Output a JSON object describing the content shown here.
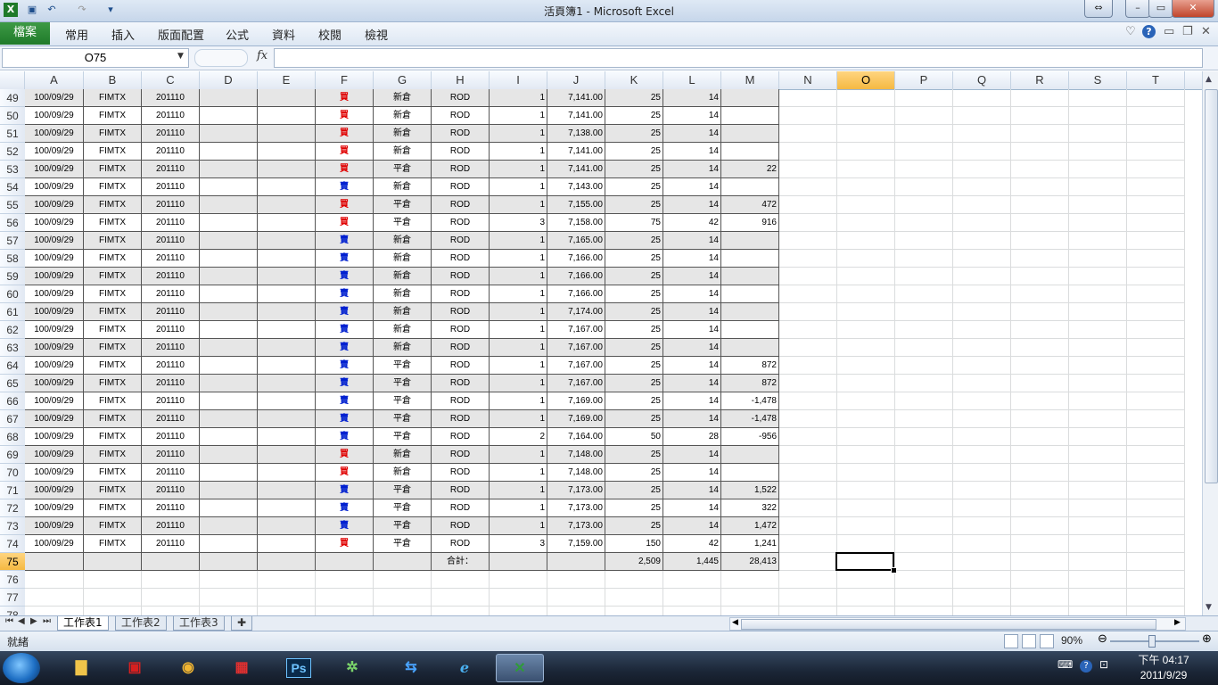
{
  "window": {
    "title": "活頁簿1 - Microsoft Excel"
  },
  "ribbon": {
    "file_tab": "檔案",
    "tabs": [
      "常用",
      "插入",
      "版面配置",
      "公式",
      "資料",
      "校閱",
      "檢視"
    ]
  },
  "formula_bar": {
    "name_box": "O75",
    "fx_label": "fx",
    "value": ""
  },
  "columns": [
    "A",
    "B",
    "C",
    "D",
    "E",
    "F",
    "G",
    "H",
    "I",
    "J",
    "K",
    "L",
    "M",
    "N",
    "O",
    "P",
    "Q",
    "R",
    "S",
    "T"
  ],
  "selected_column": "O",
  "selected_row": "75",
  "rows": [
    {
      "n": "49",
      "a": "100/09/29",
      "b": "FIMTX",
      "c": "201110",
      "f": "買",
      "side": "buy",
      "g": "新倉",
      "h": "ROD",
      "i": "1",
      "j": "7,141.00",
      "k": "25",
      "l": "14",
      "m": ""
    },
    {
      "n": "50",
      "a": "100/09/29",
      "b": "FIMTX",
      "c": "201110",
      "f": "買",
      "side": "buy",
      "g": "新倉",
      "h": "ROD",
      "i": "1",
      "j": "7,141.00",
      "k": "25",
      "l": "14",
      "m": ""
    },
    {
      "n": "51",
      "a": "100/09/29",
      "b": "FIMTX",
      "c": "201110",
      "f": "買",
      "side": "buy",
      "g": "新倉",
      "h": "ROD",
      "i": "1",
      "j": "7,138.00",
      "k": "25",
      "l": "14",
      "m": ""
    },
    {
      "n": "52",
      "a": "100/09/29",
      "b": "FIMTX",
      "c": "201110",
      "f": "買",
      "side": "buy",
      "g": "新倉",
      "h": "ROD",
      "i": "1",
      "j": "7,141.00",
      "k": "25",
      "l": "14",
      "m": ""
    },
    {
      "n": "53",
      "a": "100/09/29",
      "b": "FIMTX",
      "c": "201110",
      "f": "買",
      "side": "buy",
      "g": "平倉",
      "h": "ROD",
      "i": "1",
      "j": "7,141.00",
      "k": "25",
      "l": "14",
      "m": "22"
    },
    {
      "n": "54",
      "a": "100/09/29",
      "b": "FIMTX",
      "c": "201110",
      "f": "賣",
      "side": "sell",
      "g": "新倉",
      "h": "ROD",
      "i": "1",
      "j": "7,143.00",
      "k": "25",
      "l": "14",
      "m": ""
    },
    {
      "n": "55",
      "a": "100/09/29",
      "b": "FIMTX",
      "c": "201110",
      "f": "買",
      "side": "buy",
      "g": "平倉",
      "h": "ROD",
      "i": "1",
      "j": "7,155.00",
      "k": "25",
      "l": "14",
      "m": "472"
    },
    {
      "n": "56",
      "a": "100/09/29",
      "b": "FIMTX",
      "c": "201110",
      "f": "買",
      "side": "buy",
      "g": "平倉",
      "h": "ROD",
      "i": "3",
      "j": "7,158.00",
      "k": "75",
      "l": "42",
      "m": "916"
    },
    {
      "n": "57",
      "a": "100/09/29",
      "b": "FIMTX",
      "c": "201110",
      "f": "賣",
      "side": "sell",
      "g": "新倉",
      "h": "ROD",
      "i": "1",
      "j": "7,165.00",
      "k": "25",
      "l": "14",
      "m": ""
    },
    {
      "n": "58",
      "a": "100/09/29",
      "b": "FIMTX",
      "c": "201110",
      "f": "賣",
      "side": "sell",
      "g": "新倉",
      "h": "ROD",
      "i": "1",
      "j": "7,166.00",
      "k": "25",
      "l": "14",
      "m": ""
    },
    {
      "n": "59",
      "a": "100/09/29",
      "b": "FIMTX",
      "c": "201110",
      "f": "賣",
      "side": "sell",
      "g": "新倉",
      "h": "ROD",
      "i": "1",
      "j": "7,166.00",
      "k": "25",
      "l": "14",
      "m": ""
    },
    {
      "n": "60",
      "a": "100/09/29",
      "b": "FIMTX",
      "c": "201110",
      "f": "賣",
      "side": "sell",
      "g": "新倉",
      "h": "ROD",
      "i": "1",
      "j": "7,166.00",
      "k": "25",
      "l": "14",
      "m": ""
    },
    {
      "n": "61",
      "a": "100/09/29",
      "b": "FIMTX",
      "c": "201110",
      "f": "賣",
      "side": "sell",
      "g": "新倉",
      "h": "ROD",
      "i": "1",
      "j": "7,174.00",
      "k": "25",
      "l": "14",
      "m": ""
    },
    {
      "n": "62",
      "a": "100/09/29",
      "b": "FIMTX",
      "c": "201110",
      "f": "賣",
      "side": "sell",
      "g": "新倉",
      "h": "ROD",
      "i": "1",
      "j": "7,167.00",
      "k": "25",
      "l": "14",
      "m": ""
    },
    {
      "n": "63",
      "a": "100/09/29",
      "b": "FIMTX",
      "c": "201110",
      "f": "賣",
      "side": "sell",
      "g": "新倉",
      "h": "ROD",
      "i": "1",
      "j": "7,167.00",
      "k": "25",
      "l": "14",
      "m": ""
    },
    {
      "n": "64",
      "a": "100/09/29",
      "b": "FIMTX",
      "c": "201110",
      "f": "賣",
      "side": "sell",
      "g": "平倉",
      "h": "ROD",
      "i": "1",
      "j": "7,167.00",
      "k": "25",
      "l": "14",
      "m": "872"
    },
    {
      "n": "65",
      "a": "100/09/29",
      "b": "FIMTX",
      "c": "201110",
      "f": "賣",
      "side": "sell",
      "g": "平倉",
      "h": "ROD",
      "i": "1",
      "j": "7,167.00",
      "k": "25",
      "l": "14",
      "m": "872"
    },
    {
      "n": "66",
      "a": "100/09/29",
      "b": "FIMTX",
      "c": "201110",
      "f": "賣",
      "side": "sell",
      "g": "平倉",
      "h": "ROD",
      "i": "1",
      "j": "7,169.00",
      "k": "25",
      "l": "14",
      "m": "-1,478"
    },
    {
      "n": "67",
      "a": "100/09/29",
      "b": "FIMTX",
      "c": "201110",
      "f": "賣",
      "side": "sell",
      "g": "平倉",
      "h": "ROD",
      "i": "1",
      "j": "7,169.00",
      "k": "25",
      "l": "14",
      "m": "-1,478"
    },
    {
      "n": "68",
      "a": "100/09/29",
      "b": "FIMTX",
      "c": "201110",
      "f": "賣",
      "side": "sell",
      "g": "平倉",
      "h": "ROD",
      "i": "2",
      "j": "7,164.00",
      "k": "50",
      "l": "28",
      "m": "-956"
    },
    {
      "n": "69",
      "a": "100/09/29",
      "b": "FIMTX",
      "c": "201110",
      "f": "買",
      "side": "buy",
      "g": "新倉",
      "h": "ROD",
      "i": "1",
      "j": "7,148.00",
      "k": "25",
      "l": "14",
      "m": ""
    },
    {
      "n": "70",
      "a": "100/09/29",
      "b": "FIMTX",
      "c": "201110",
      "f": "買",
      "side": "buy",
      "g": "新倉",
      "h": "ROD",
      "i": "1",
      "j": "7,148.00",
      "k": "25",
      "l": "14",
      "m": ""
    },
    {
      "n": "71",
      "a": "100/09/29",
      "b": "FIMTX",
      "c": "201110",
      "f": "賣",
      "side": "sell",
      "g": "平倉",
      "h": "ROD",
      "i": "1",
      "j": "7,173.00",
      "k": "25",
      "l": "14",
      "m": "1,522"
    },
    {
      "n": "72",
      "a": "100/09/29",
      "b": "FIMTX",
      "c": "201110",
      "f": "賣",
      "side": "sell",
      "g": "平倉",
      "h": "ROD",
      "i": "1",
      "j": "7,173.00",
      "k": "25",
      "l": "14",
      "m": "322"
    },
    {
      "n": "73",
      "a": "100/09/29",
      "b": "FIMTX",
      "c": "201110",
      "f": "賣",
      "side": "sell",
      "g": "平倉",
      "h": "ROD",
      "i": "1",
      "j": "7,173.00",
      "k": "25",
      "l": "14",
      "m": "1,472"
    },
    {
      "n": "74",
      "a": "100/09/29",
      "b": "FIMTX",
      "c": "201110",
      "f": "買",
      "side": "buy",
      "g": "平倉",
      "h": "ROD",
      "i": "3",
      "j": "7,159.00",
      "k": "150",
      "l": "42",
      "m": "1,241"
    }
  ],
  "total_row": {
    "n": "75",
    "label": "合計：",
    "k": "2,509",
    "l": "1,445",
    "m": "28,413"
  },
  "empty_rows": [
    "76",
    "77",
    "78"
  ],
  "sheet_tabs": [
    "工作表1",
    "工作表2",
    "工作表3"
  ],
  "status": {
    "text": "就緒",
    "zoom": "90%"
  },
  "taskbar": {
    "time": "下午 04:17",
    "date": "2011/9/29",
    "ps_label": "Ps"
  },
  "colors": {
    "buy": "#e00000",
    "sell": "#0020d0",
    "band": "#e6e6e6",
    "selected_header": "#f5b942",
    "file_tab": "#1f7a2a"
  }
}
